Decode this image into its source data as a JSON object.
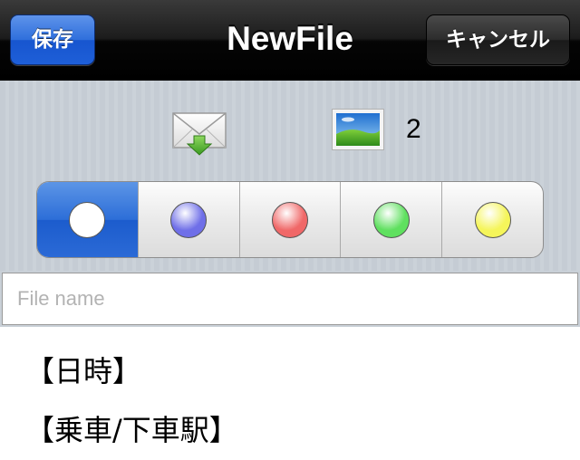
{
  "navbar": {
    "title": "NewFile",
    "save_label": "保存",
    "cancel_label": "キャンセル"
  },
  "attachments": {
    "mail_icon": "mail-download-icon",
    "photo_icon": "photo-icon",
    "photo_count": "2"
  },
  "color_picker": {
    "selected_index": 0,
    "colors": [
      {
        "name": "white",
        "hex": "#ffffff"
      },
      {
        "name": "blue",
        "hex": "#6f6fe8"
      },
      {
        "name": "red",
        "hex": "#f06868"
      },
      {
        "name": "green",
        "hex": "#5fe05f"
      },
      {
        "name": "yellow",
        "hex": "#f5f55a"
      }
    ],
    "accent": "#2d6ed8"
  },
  "file_name": {
    "placeholder": "File name",
    "value": ""
  },
  "body": {
    "lines": [
      "【日時】",
      "【乗車/下車駅】"
    ]
  }
}
